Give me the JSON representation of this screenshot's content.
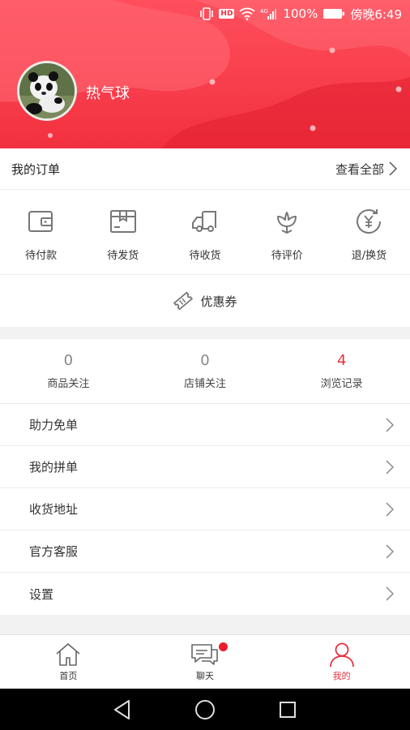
{
  "status_bar": {
    "battery": "100%",
    "time": "傍晚6:49",
    "network": "4G",
    "hd": "HD"
  },
  "profile": {
    "username": "热气球"
  },
  "orders": {
    "title": "我的订单",
    "view_all": "查看全部",
    "statuses": [
      {
        "label": "待付款",
        "icon": "wallet-icon"
      },
      {
        "label": "待发货",
        "icon": "package-icon"
      },
      {
        "label": "待收货",
        "icon": "truck-icon"
      },
      {
        "label": "待评价",
        "icon": "flower-icon"
      },
      {
        "label": "退/换货",
        "icon": "yen-refund-icon"
      }
    ],
    "coupon": "优惠券"
  },
  "stats": [
    {
      "value": "0",
      "label": "商品关注"
    },
    {
      "value": "0",
      "label": "店铺关注"
    },
    {
      "value": "4",
      "label": "浏览记录"
    }
  ],
  "menu": [
    {
      "label": "助力免单"
    },
    {
      "label": "我的拼单"
    },
    {
      "label": "收货地址"
    },
    {
      "label": "官方客服"
    },
    {
      "label": "设置"
    }
  ],
  "tabs": [
    {
      "label": "首页",
      "icon": "home-icon"
    },
    {
      "label": "聊天",
      "icon": "chat-icon"
    },
    {
      "label": "我的",
      "icon": "user-icon"
    }
  ],
  "colors": {
    "accent": "#e8303f",
    "header": "#f2303f"
  }
}
